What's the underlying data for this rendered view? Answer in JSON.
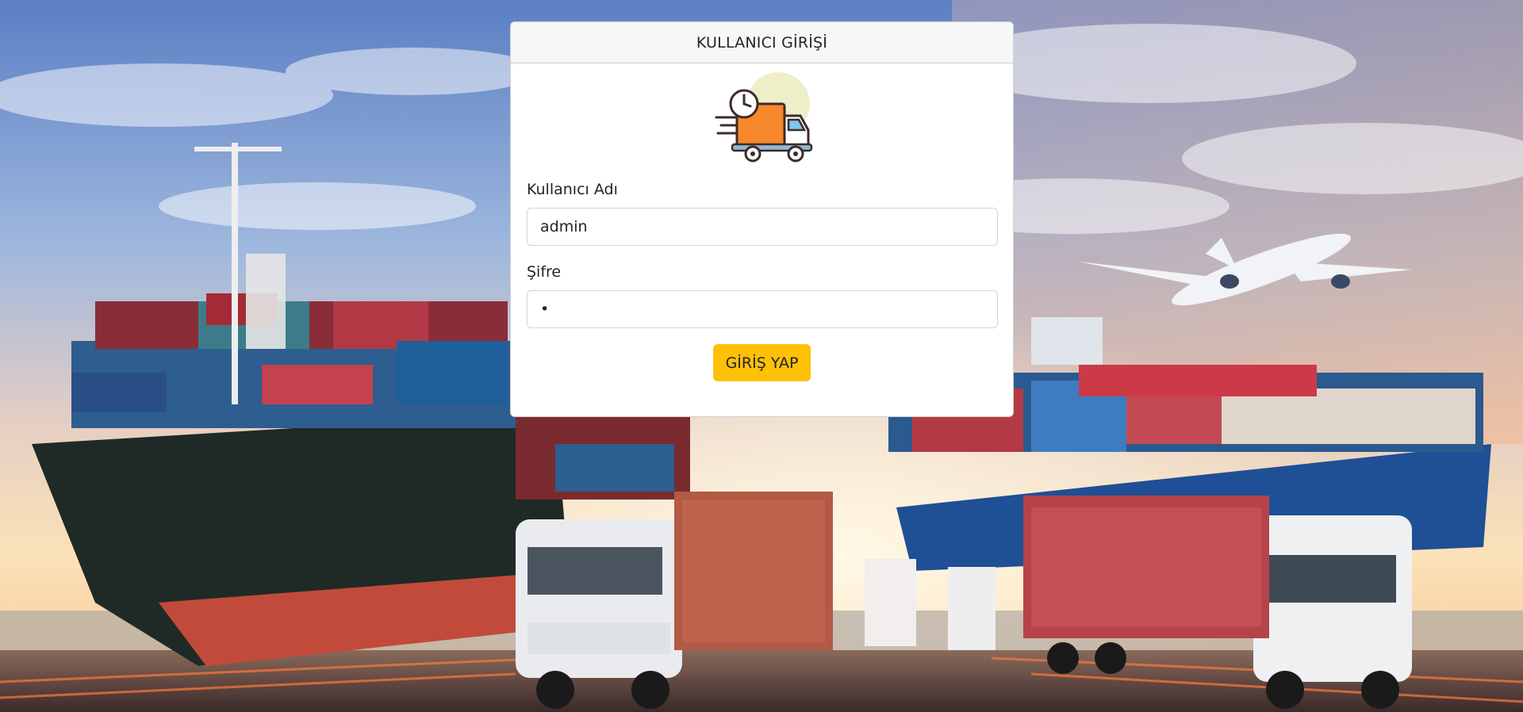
{
  "login": {
    "header_title": "KULLANICI GİRİŞİ",
    "username_label": "Kullanıcı Adı",
    "username_value": "admin",
    "password_label": "Şifre",
    "password_value": "•",
    "submit_label": "GİRİŞ YAP"
  },
  "colors": {
    "accent": "#ffc107",
    "header_bg": "#f7f7f7",
    "truck_orange": "#f7882b"
  },
  "icons": {
    "logo": "delivery-truck-icon"
  }
}
